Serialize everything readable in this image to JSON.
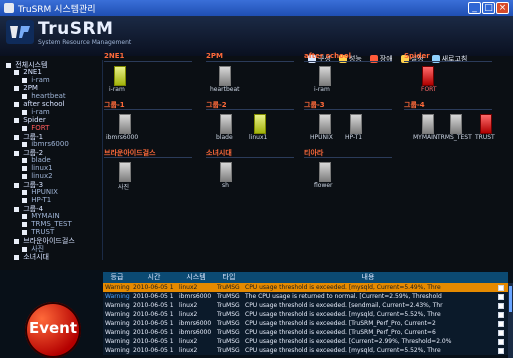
{
  "window": {
    "title": "TruSRM 시스템관리",
    "min": "_",
    "max": "□",
    "close": "×"
  },
  "header": {
    "brand": "TruSRM",
    "tagline": "System Resource Management",
    "nav": [
      {
        "label": "구성",
        "icon": "gear-icon",
        "color": "#dbe7ff"
      },
      {
        "label": "성능",
        "icon": "chart-icon",
        "color": "#ffd24d"
      },
      {
        "label": "장애",
        "icon": "alert-icon",
        "color": "#ff5a3a"
      },
      {
        "label": "설정",
        "icon": "folder-icon",
        "color": "#ffd24d"
      },
      {
        "label": "새로고침",
        "icon": "refresh-icon",
        "color": "#8fd1ff"
      }
    ]
  },
  "tree": {
    "root": "전체시스템",
    "items": [
      {
        "label": "2NE1",
        "level": 1
      },
      {
        "label": "i-ram",
        "level": 2
      },
      {
        "label": "2PM",
        "level": 1
      },
      {
        "label": "heartbeat",
        "level": 2
      },
      {
        "label": "after school",
        "level": 1
      },
      {
        "label": "i-ram",
        "level": 2
      },
      {
        "label": "Spider",
        "level": 1
      },
      {
        "label": "FORT",
        "level": 2
      },
      {
        "label": "그룹-1",
        "level": 1
      },
      {
        "label": "ibmrs6000",
        "level": 2
      },
      {
        "label": "그룹-2",
        "level": 1
      },
      {
        "label": "blade",
        "level": 2
      },
      {
        "label": "linux1",
        "level": 2
      },
      {
        "label": "linux2",
        "level": 2
      },
      {
        "label": "그룹-3",
        "level": 1
      },
      {
        "label": "HPUNIX",
        "level": 2
      },
      {
        "label": "HP-T1",
        "level": 2
      },
      {
        "label": "그룹-4",
        "level": 1
      },
      {
        "label": "MYMAIN",
        "level": 2
      },
      {
        "label": "TRMS_TEST",
        "level": 2
      },
      {
        "label": "TRUST",
        "level": 2
      },
      {
        "label": "브라운아이드걸스",
        "level": 1
      },
      {
        "label": "사진",
        "level": 2
      },
      {
        "label": "소녀시대",
        "level": 1
      },
      {
        "label": "sh",
        "level": 2
      },
      {
        "label": "티아라",
        "level": 1
      },
      {
        "label": "flower",
        "level": 2
      }
    ]
  },
  "grid": {
    "groups": [
      {
        "title": "2NE1",
        "devices": [
          {
            "label": "i-ram",
            "status": "yellow"
          }
        ]
      },
      {
        "title": "2PM",
        "devices": [
          {
            "label": "heartbeat",
            "status": "gray"
          }
        ]
      },
      {
        "title": "after school",
        "devices": [
          {
            "label": "i-ram",
            "status": "gray"
          }
        ]
      },
      {
        "title": "Spider",
        "devices": [
          {
            "label": "FORT",
            "status": "red"
          }
        ]
      },
      {
        "title": "그룹-1",
        "devices": [
          {
            "label": "ibmrs6000",
            "status": "gray"
          }
        ]
      },
      {
        "title": "그룹-2",
        "devices": [
          {
            "label": "blade",
            "status": "gray"
          },
          {
            "label": "linux1",
            "status": "yellow"
          }
        ]
      },
      {
        "title": "그룹-3",
        "devices": [
          {
            "label": "HPUNIX",
            "status": "gray"
          },
          {
            "label": "HP-T1",
            "status": "gray"
          }
        ]
      },
      {
        "title": "그룹-4",
        "devices": [
          {
            "label": "MYMAIN",
            "status": "gray"
          },
          {
            "label": "TRMS_TEST",
            "status": "gray"
          },
          {
            "label": "TRUST",
            "status": "red"
          }
        ]
      },
      {
        "title": "브라운아이드걸스",
        "devices": [
          {
            "label": "사진",
            "status": "gray"
          }
        ]
      },
      {
        "title": "소녀시대",
        "devices": [
          {
            "label": "sh",
            "status": "gray"
          }
        ]
      },
      {
        "title": "티아라",
        "devices": [
          {
            "label": "flower",
            "status": "gray"
          }
        ]
      }
    ]
  },
  "events": {
    "button_label": "Event",
    "headers": [
      "등급",
      "시간",
      "시스템",
      "타입",
      "내용"
    ],
    "rows": [
      {
        "level": "Warning",
        "time": "2010-06-05 1",
        "system": "linux2",
        "type": "TruMSG",
        "msg": "CPU usage threshold is exceeded. [mysqld, Current=5.49%, Thre"
      },
      {
        "level": "Warning",
        "time": "2010-06-05 1",
        "system": "ibmrs6000",
        "type": "TruMSG",
        "msg": "The CPU usage is returned to normal. [Current=2.59%, Threshold"
      },
      {
        "level": "Warning",
        "time": "2010-06-05 1",
        "system": "linux2",
        "type": "TruMSG",
        "msg": "CPU usage threshold is exceeded. [sendmail, Current=2.43%, Thr"
      },
      {
        "level": "Warning",
        "time": "2010-06-05 1",
        "system": "linux2",
        "type": "TruMSG",
        "msg": "CPU usage threshold is exceeded. [mysqld, Current=5.52%, Thre"
      },
      {
        "level": "Warning",
        "time": "2010-06-05 1",
        "system": "ibmrs6000",
        "type": "TruMSG",
        "msg": "CPU usage threshold is exceeded. [TruSRM_Perf_Pro, Current=2"
      },
      {
        "level": "Warning",
        "time": "2010-06-05 1",
        "system": "ibmrs6000",
        "type": "TruMSG",
        "msg": "CPU usage threshold is exceeded. [TruSRM_Perf_Pro, Current=6"
      },
      {
        "level": "Warning",
        "time": "2010-06-05 1",
        "system": "linux2",
        "type": "TruMSG",
        "msg": "CPU usage threshold is exceeded. [Current=2.99%, Threshold=2.0%"
      },
      {
        "level": "Warning",
        "time": "2010-06-05 1",
        "system": "linux2",
        "type": "TruMSG",
        "msg": "CPU usage threshold is exceeded. [mysqld, Current=5.52%, Thre"
      }
    ]
  }
}
